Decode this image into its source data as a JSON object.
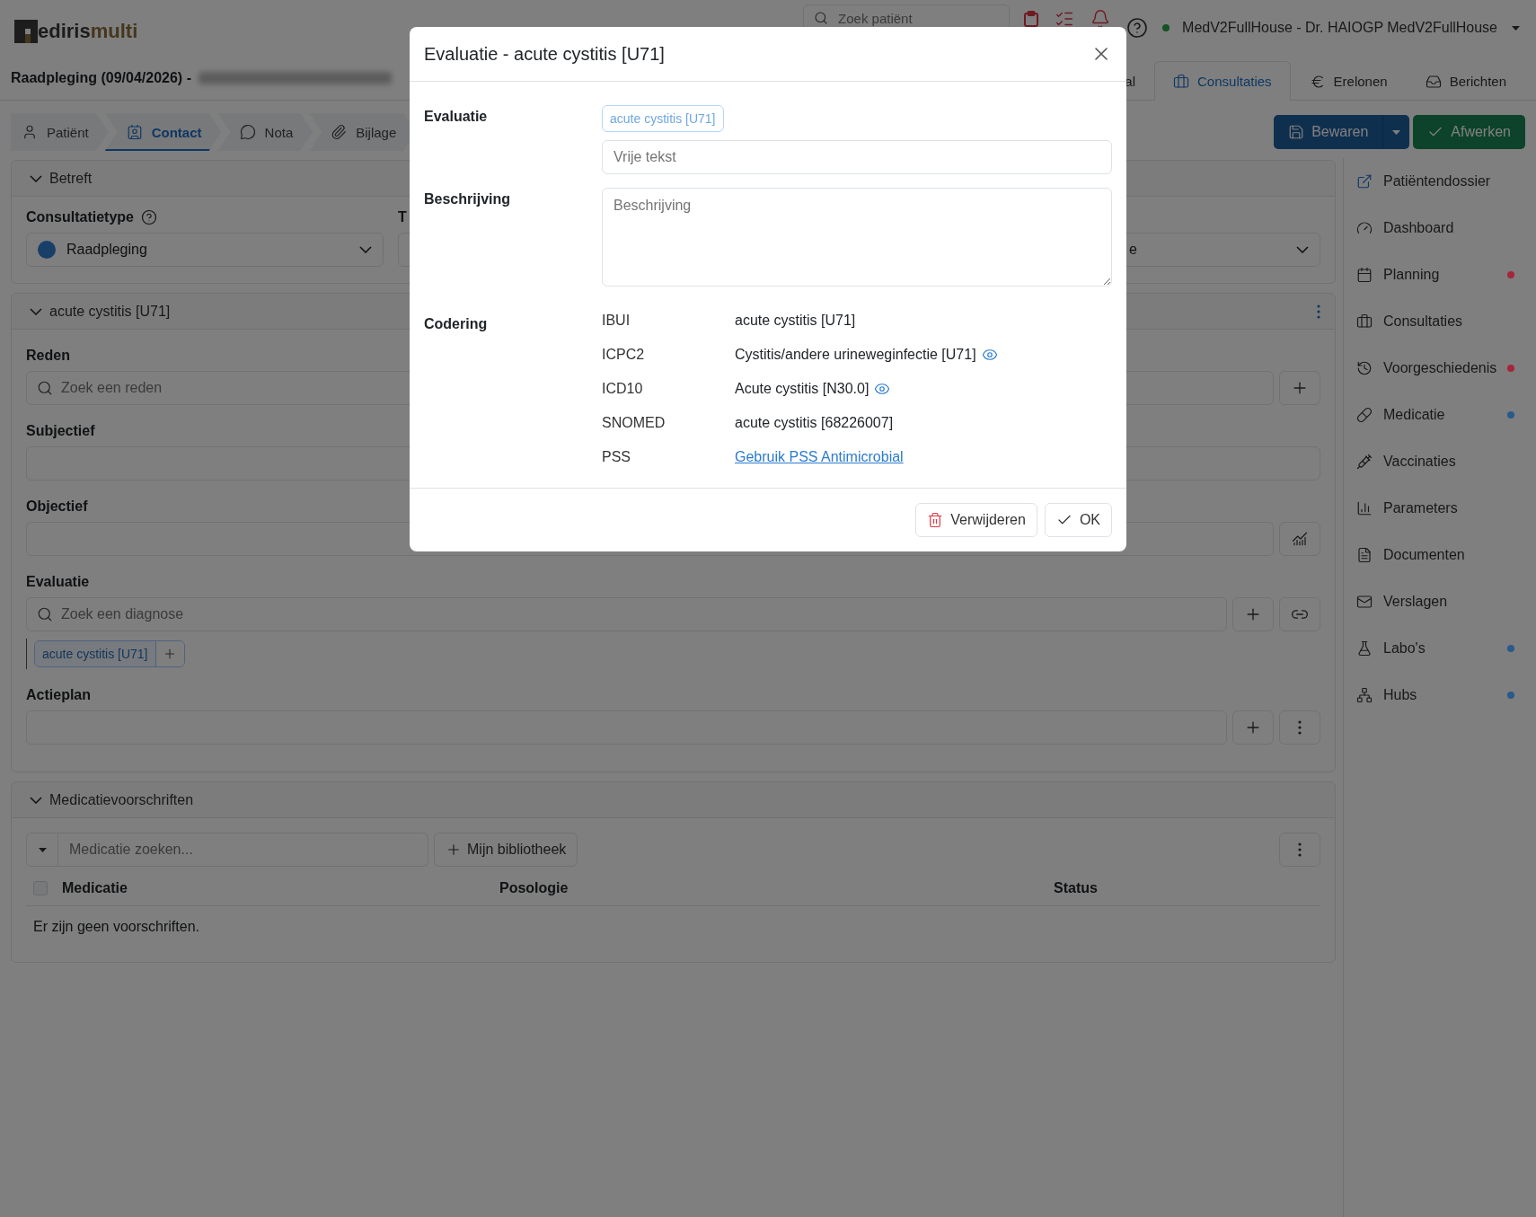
{
  "app": {
    "logo": {
      "name": "ediris",
      "accent": "multi"
    },
    "search": {
      "placeholder": "Zoek patiënt"
    },
    "user": "MedV2FullHouse - Dr. HAIOGP MedV2FullHouse"
  },
  "header": {
    "title": "Raadpleging (09/04/2026) -",
    "tabs": [
      {
        "label": "al",
        "selected": false
      },
      {
        "label": "Consultaties",
        "selected": true
      },
      {
        "label": "Erelonen",
        "selected": false
      },
      {
        "label": "Berichten",
        "selected": false
      }
    ]
  },
  "steps": [
    {
      "label": "Patiënt",
      "selected": false
    },
    {
      "label": "Contact",
      "selected": true
    },
    {
      "label": "Nota",
      "selected": false
    },
    {
      "label": "Bijlage",
      "selected": false
    }
  ],
  "actions": {
    "save": "Bewaren",
    "finish": "Afwerken"
  },
  "betreft": {
    "title": "Betreft",
    "consultatietype": {
      "label": "Consultatietype",
      "value": "Raadpleging"
    },
    "column_2": {
      "label": "T"
    },
    "column_3": {
      "value": "e"
    }
  },
  "problem": {
    "title": "acute cystitis [U71]",
    "fields": [
      {
        "kind": "reason",
        "label": "Reden",
        "placeholder": "Zoek een reden"
      },
      {
        "kind": "text",
        "label": "Subjectief"
      },
      {
        "kind": "chart",
        "label": "Objectief"
      },
      {
        "kind": "diagnosis",
        "label": "Evaluatie",
        "placeholder": "Zoek een diagnose",
        "tags": [
          "acute cystitis [U71]"
        ]
      },
      {
        "kind": "plan",
        "label": "Actieplan"
      }
    ]
  },
  "medication": {
    "title": "Medicatievoorschriften",
    "search": {
      "placeholder": "Medicatie zoeken..."
    },
    "library": "Mijn bibliotheek",
    "select_all": {
      "checked": false
    },
    "columns": [
      "Medicatie",
      "Posologie",
      "Status"
    ],
    "empty": "Er zijn geen voorschriften."
  },
  "sidebar": {
    "items": [
      {
        "label": "Patiëntendossier"
      },
      {
        "label": "Dashboard"
      },
      {
        "label": "Planning",
        "color": "#a3263a"
      },
      {
        "label": "Consultaties"
      },
      {
        "label": "Voorgeschiedenis",
        "color": "#a3263a"
      },
      {
        "label": "Medicatie",
        "color": "#285a8c"
      },
      {
        "label": "Vaccinaties"
      },
      {
        "label": "Parameters"
      },
      {
        "label": "Documenten"
      },
      {
        "label": "Verslagen"
      },
      {
        "label": "Labo's",
        "color": "#285a8c"
      },
      {
        "label": "Hubs",
        "color": "#285a8c"
      }
    ]
  },
  "modal": {
    "title": "Evaluatie - acute cystitis [U71]",
    "evaluation": {
      "label": "Evaluatie",
      "tag": "acute cystitis [U71]",
      "placeholder": "Vrije tekst"
    },
    "description": {
      "label": "Beschrijving",
      "placeholder": "Beschrijving"
    },
    "coding": {
      "label": "Codering",
      "rows": [
        {
          "code": "IBUI",
          "kind": "text",
          "value": "acute cystitis [U71]",
          "details": false
        },
        {
          "code": "ICPC2",
          "kind": "text",
          "value": "Cystitis/andere urineweginfectie [U71]",
          "details": true
        },
        {
          "code": "ICD10",
          "kind": "text",
          "value": "Acute cystitis [N30.0]",
          "details": true
        },
        {
          "code": "SNOMED",
          "kind": "text",
          "value": "acute cystitis [68226007]",
          "details": false
        },
        {
          "code": "PSS",
          "kind": "link",
          "value": "Gebruik PSS Antimicrobial",
          "details": false
        }
      ]
    },
    "buttons": {
      "delete": "Verwijderen",
      "ok": "OK"
    }
  }
}
